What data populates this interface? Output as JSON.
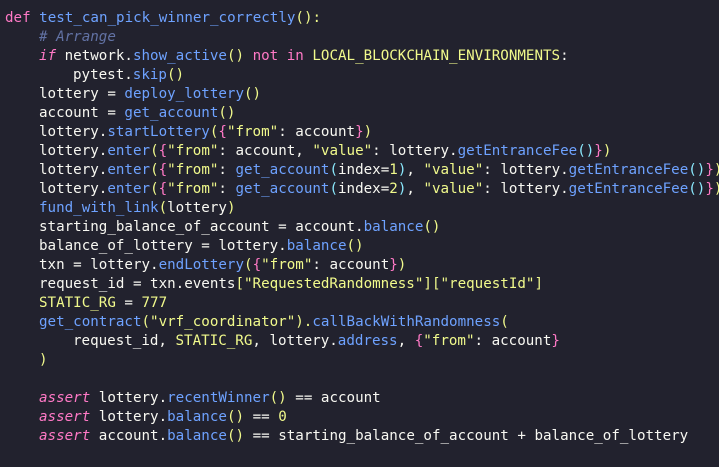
{
  "theme": {
    "background": "#22222e",
    "colors": {
      "kw": "#ff79c6",
      "fn": "#6ea2ff",
      "plain": "#f8f8f2",
      "paren": "#f1fa8c",
      "paren2": "#ff79c6",
      "paren3": "#8be9fd",
      "comment": "#6272a4",
      "string": "#f1fa8c",
      "number": "#f1fa8c",
      "const": "#f1fa8c",
      "attr": "#6ea2ff"
    }
  },
  "code": {
    "lines": [
      {
        "indent": 0,
        "tokens": [
          {
            "t": "def ",
            "c": "kw"
          },
          {
            "t": "test_can_pick_winner_correctly",
            "c": "fn"
          },
          {
            "t": "():",
            "c": "paren"
          }
        ]
      },
      {
        "indent": 1,
        "tokens": [
          {
            "t": "# Arrange",
            "c": "comment",
            "italic": true
          }
        ]
      },
      {
        "indent": 1,
        "tokens": [
          {
            "t": "if ",
            "c": "kw",
            "italic": true
          },
          {
            "t": "network.",
            "c": "plain"
          },
          {
            "t": "show_active",
            "c": "fn"
          },
          {
            "t": "() ",
            "c": "paren"
          },
          {
            "t": "not in ",
            "c": "kw"
          },
          {
            "t": "LOCAL_BLOCKCHAIN_ENVIRONMENTS",
            "c": "const"
          },
          {
            "t": ":",
            "c": "plain"
          }
        ]
      },
      {
        "indent": 2,
        "tokens": [
          {
            "t": "pytest.",
            "c": "plain"
          },
          {
            "t": "skip",
            "c": "fn"
          },
          {
            "t": "()",
            "c": "paren"
          }
        ]
      },
      {
        "indent": 1,
        "tokens": [
          {
            "t": "lottery = ",
            "c": "plain"
          },
          {
            "t": "deploy_lottery",
            "c": "fn"
          },
          {
            "t": "()",
            "c": "paren"
          }
        ]
      },
      {
        "indent": 1,
        "tokens": [
          {
            "t": "account = ",
            "c": "plain"
          },
          {
            "t": "get_account",
            "c": "fn"
          },
          {
            "t": "()",
            "c": "paren"
          }
        ]
      },
      {
        "indent": 1,
        "tokens": [
          {
            "t": "lottery.",
            "c": "plain"
          },
          {
            "t": "startLottery",
            "c": "fn"
          },
          {
            "t": "(",
            "c": "paren"
          },
          {
            "t": "{",
            "c": "paren2"
          },
          {
            "t": "\"from\"",
            "c": "string"
          },
          {
            "t": ": account",
            "c": "plain"
          },
          {
            "t": "}",
            "c": "paren2"
          },
          {
            "t": ")",
            "c": "paren"
          }
        ]
      },
      {
        "indent": 1,
        "tokens": [
          {
            "t": "lottery.",
            "c": "plain"
          },
          {
            "t": "enter",
            "c": "fn"
          },
          {
            "t": "(",
            "c": "paren"
          },
          {
            "t": "{",
            "c": "paren2"
          },
          {
            "t": "\"from\"",
            "c": "string"
          },
          {
            "t": ": account, ",
            "c": "plain"
          },
          {
            "t": "\"value\"",
            "c": "string"
          },
          {
            "t": ": lottery.",
            "c": "plain"
          },
          {
            "t": "getEntranceFee",
            "c": "fn"
          },
          {
            "t": "()",
            "c": "paren3"
          },
          {
            "t": "}",
            "c": "paren2"
          },
          {
            "t": ")",
            "c": "paren"
          }
        ]
      },
      {
        "indent": 1,
        "tokens": [
          {
            "t": "lottery.",
            "c": "plain"
          },
          {
            "t": "enter",
            "c": "fn"
          },
          {
            "t": "(",
            "c": "paren"
          },
          {
            "t": "{",
            "c": "paren2"
          },
          {
            "t": "\"from\"",
            "c": "string"
          },
          {
            "t": ": ",
            "c": "plain"
          },
          {
            "t": "get_account",
            "c": "fn"
          },
          {
            "t": "(",
            "c": "paren3"
          },
          {
            "t": "index=",
            "c": "plain"
          },
          {
            "t": "1",
            "c": "number"
          },
          {
            "t": ")",
            "c": "paren3"
          },
          {
            "t": ", ",
            "c": "plain"
          },
          {
            "t": "\"value\"",
            "c": "string"
          },
          {
            "t": ": lottery.",
            "c": "plain"
          },
          {
            "t": "getEntranceFee",
            "c": "fn"
          },
          {
            "t": "()",
            "c": "paren3"
          },
          {
            "t": "}",
            "c": "paren2"
          },
          {
            "t": ")",
            "c": "paren"
          }
        ]
      },
      {
        "indent": 1,
        "tokens": [
          {
            "t": "lottery.",
            "c": "plain"
          },
          {
            "t": "enter",
            "c": "fn"
          },
          {
            "t": "(",
            "c": "paren"
          },
          {
            "t": "{",
            "c": "paren2"
          },
          {
            "t": "\"from\"",
            "c": "string"
          },
          {
            "t": ": ",
            "c": "plain"
          },
          {
            "t": "get_account",
            "c": "fn"
          },
          {
            "t": "(",
            "c": "paren3"
          },
          {
            "t": "index=",
            "c": "plain"
          },
          {
            "t": "2",
            "c": "number"
          },
          {
            "t": ")",
            "c": "paren3"
          },
          {
            "t": ", ",
            "c": "plain"
          },
          {
            "t": "\"value\"",
            "c": "string"
          },
          {
            "t": ": lottery.",
            "c": "plain"
          },
          {
            "t": "getEntranceFee",
            "c": "fn"
          },
          {
            "t": "()",
            "c": "paren3"
          },
          {
            "t": "}",
            "c": "paren2"
          },
          {
            "t": ")",
            "c": "paren"
          }
        ]
      },
      {
        "indent": 1,
        "tokens": [
          {
            "t": "fund_with_link",
            "c": "fn"
          },
          {
            "t": "(",
            "c": "paren"
          },
          {
            "t": "lottery",
            "c": "plain"
          },
          {
            "t": ")",
            "c": "paren"
          }
        ]
      },
      {
        "indent": 1,
        "tokens": [
          {
            "t": "starting_balance_of_account = account.",
            "c": "plain"
          },
          {
            "t": "balance",
            "c": "fn"
          },
          {
            "t": "()",
            "c": "paren"
          }
        ]
      },
      {
        "indent": 1,
        "tokens": [
          {
            "t": "balance_of_lottery = lottery.",
            "c": "plain"
          },
          {
            "t": "balance",
            "c": "fn"
          },
          {
            "t": "()",
            "c": "paren"
          }
        ]
      },
      {
        "indent": 1,
        "tokens": [
          {
            "t": "txn = lottery.",
            "c": "plain"
          },
          {
            "t": "endLottery",
            "c": "fn"
          },
          {
            "t": "(",
            "c": "paren"
          },
          {
            "t": "{",
            "c": "paren2"
          },
          {
            "t": "\"from\"",
            "c": "string"
          },
          {
            "t": ": account",
            "c": "plain"
          },
          {
            "t": "}",
            "c": "paren2"
          },
          {
            "t": ")",
            "c": "paren"
          }
        ]
      },
      {
        "indent": 1,
        "tokens": [
          {
            "t": "request_id = txn.events",
            "c": "plain"
          },
          {
            "t": "[",
            "c": "paren"
          },
          {
            "t": "\"RequestedRandomness\"",
            "c": "string"
          },
          {
            "t": "]",
            "c": "paren"
          },
          {
            "t": "[",
            "c": "paren"
          },
          {
            "t": "\"requestId\"",
            "c": "string"
          },
          {
            "t": "]",
            "c": "paren"
          }
        ]
      },
      {
        "indent": 1,
        "tokens": [
          {
            "t": "STATIC_RG",
            "c": "const"
          },
          {
            "t": " = ",
            "c": "plain"
          },
          {
            "t": "777",
            "c": "number"
          }
        ]
      },
      {
        "indent": 1,
        "tokens": [
          {
            "t": "get_contract",
            "c": "fn"
          },
          {
            "t": "(",
            "c": "paren"
          },
          {
            "t": "\"vrf_coordinator\"",
            "c": "string"
          },
          {
            "t": ").",
            "c": "paren"
          },
          {
            "t": "callBackWithRandomness",
            "c": "fn"
          },
          {
            "t": "(",
            "c": "paren"
          }
        ]
      },
      {
        "indent": 2,
        "tokens": [
          {
            "t": "request_id, ",
            "c": "plain"
          },
          {
            "t": "STATIC_RG",
            "c": "const"
          },
          {
            "t": ", lottery.",
            "c": "plain"
          },
          {
            "t": "address",
            "c": "fn"
          },
          {
            "t": ", ",
            "c": "plain"
          },
          {
            "t": "{",
            "c": "paren2"
          },
          {
            "t": "\"from\"",
            "c": "string"
          },
          {
            "t": ": account",
            "c": "plain"
          },
          {
            "t": "}",
            "c": "paren2"
          }
        ]
      },
      {
        "indent": 1,
        "tokens": [
          {
            "t": ")",
            "c": "paren"
          }
        ]
      },
      {
        "indent": 0,
        "tokens": []
      },
      {
        "indent": 1,
        "tokens": [
          {
            "t": "assert ",
            "c": "kw",
            "italic": true
          },
          {
            "t": "lottery.",
            "c": "plain"
          },
          {
            "t": "recentWinner",
            "c": "fn"
          },
          {
            "t": "()",
            "c": "paren"
          },
          {
            "t": " == account",
            "c": "plain"
          }
        ]
      },
      {
        "indent": 1,
        "tokens": [
          {
            "t": "assert ",
            "c": "kw",
            "italic": true
          },
          {
            "t": "lottery.",
            "c": "plain"
          },
          {
            "t": "balance",
            "c": "fn"
          },
          {
            "t": "()",
            "c": "paren"
          },
          {
            "t": " == ",
            "c": "plain"
          },
          {
            "t": "0",
            "c": "number"
          }
        ]
      },
      {
        "indent": 1,
        "tokens": [
          {
            "t": "assert ",
            "c": "kw",
            "italic": true
          },
          {
            "t": "account.",
            "c": "plain"
          },
          {
            "t": "balance",
            "c": "fn"
          },
          {
            "t": "()",
            "c": "paren"
          },
          {
            "t": " == starting_balance_of_account + balance_of_lottery",
            "c": "plain"
          }
        ]
      }
    ]
  }
}
